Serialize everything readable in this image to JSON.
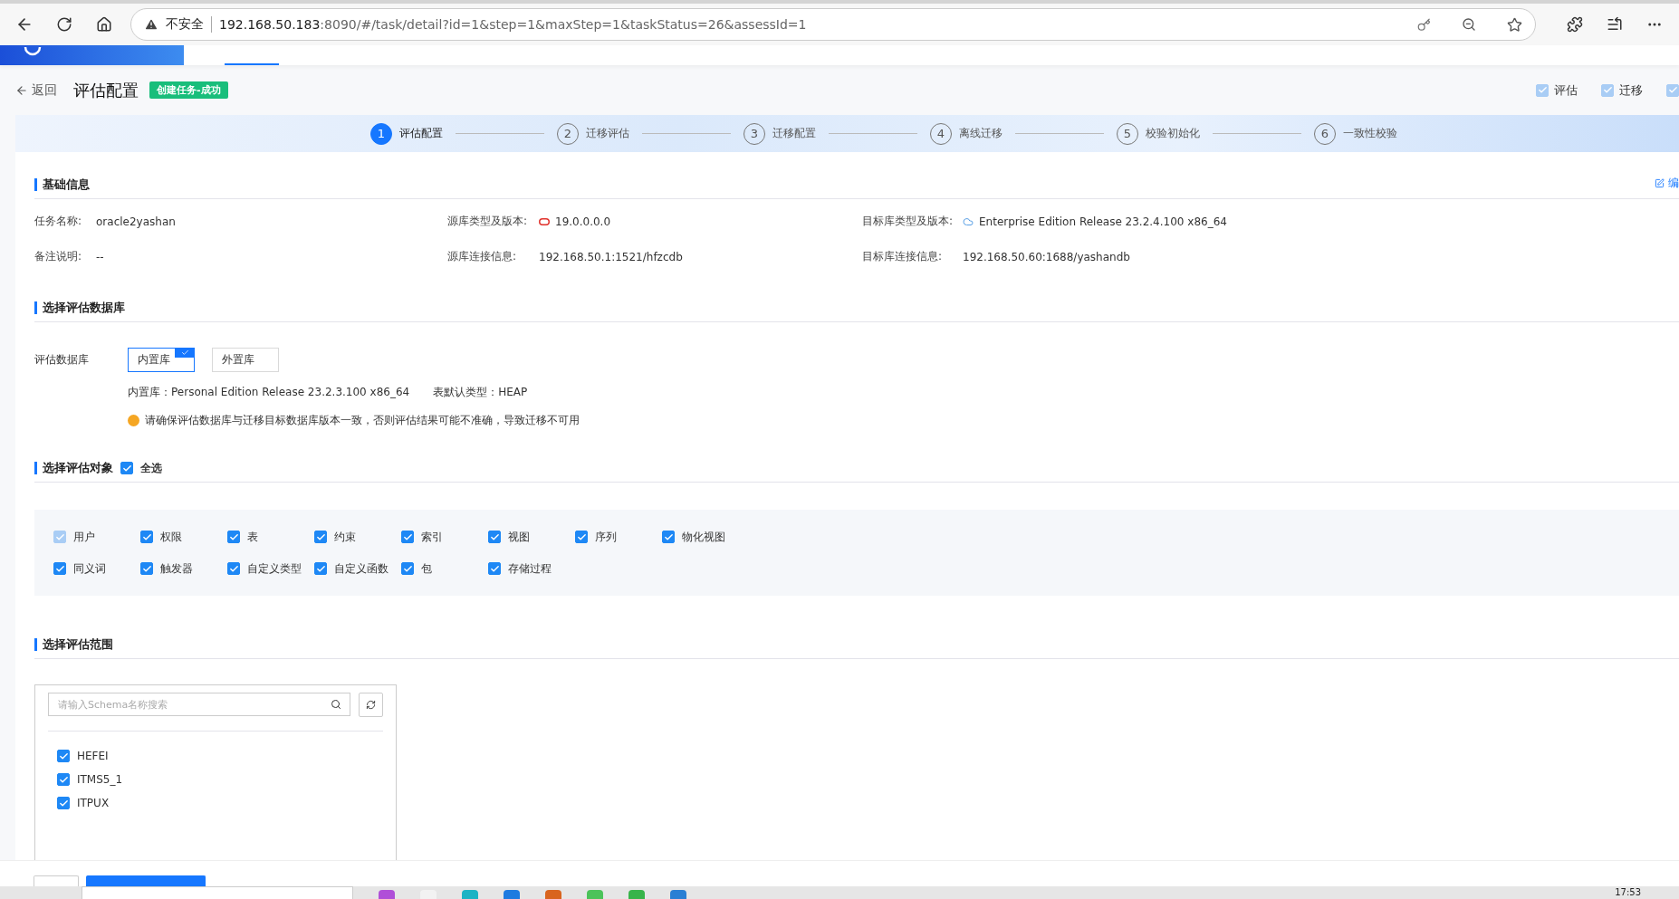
{
  "browser": {
    "security": "不安全",
    "url_host": "192.168.50.183",
    "url_rest": ":8090/#/task/detail?id=1&step=1&maxStep=1&taskStatus=26&assessId=1"
  },
  "app_header": {
    "nav": [
      {
        "selected": true
      },
      {
        "selected": false
      }
    ]
  },
  "page_header": {
    "back": "返回",
    "title": "评估配置",
    "badge": "创建任务-成功",
    "toggles": [
      {
        "label": "评估",
        "checked": true
      },
      {
        "label": "迁移",
        "checked": true
      },
      {
        "checked": true
      }
    ]
  },
  "steps": [
    {
      "number": "1",
      "label": "评估配置",
      "selected": true
    },
    {
      "number": "2",
      "label": "迁移评估",
      "selected": false
    },
    {
      "number": "3",
      "label": "迁移配置",
      "selected": false
    },
    {
      "number": "4",
      "label": "离线迁移",
      "selected": false
    },
    {
      "number": "5",
      "label": "校验初始化",
      "selected": false
    },
    {
      "number": "6",
      "label": "一致性校验",
      "selected": false
    }
  ],
  "basic_info": {
    "title": "基础信息",
    "edit": "编",
    "fields": [
      {
        "label": "任务名称:",
        "value": "oracle2yashan"
      },
      {
        "label": "源库类型及版本:",
        "value": "19.0.0.0.0",
        "kind": "oracle"
      },
      {
        "label": "目标库类型及版本:",
        "value": "Enterprise Edition Release 23.2.4.100 x86_64",
        "kind": "yashan"
      },
      {
        "label": "备注说明:",
        "value": "--"
      },
      {
        "label": "源库连接信息:",
        "value": "192.168.50.1:1521/hfzcdb"
      },
      {
        "label": "目标库连接信息:",
        "value": "192.168.50.60:1688/yashandb"
      }
    ]
  },
  "assess_db": {
    "title": "选择评估数据库",
    "label": "评估数据库",
    "options": [
      {
        "label": "内置库",
        "selected": true
      },
      {
        "label": "外置库",
        "selected": false
      }
    ],
    "info": "内置库：Personal Edition Release 23.2.3.100 x86_64",
    "table_type": "表默认类型：HEAP",
    "warning": "请确保评估数据库与迁移目标数据库版本一致，否则评估结果可能不准确，导致迁移不可用"
  },
  "objects": {
    "title": "选择评估对象",
    "select_all": {
      "label": "全选",
      "checked": true
    },
    "items": [
      {
        "label": "用户",
        "checked": true,
        "disabled": true
      },
      {
        "label": "权限",
        "checked": true,
        "disabled": false
      },
      {
        "label": "表",
        "checked": true,
        "disabled": false
      },
      {
        "label": "约束",
        "checked": true,
        "disabled": false
      },
      {
        "label": "索引",
        "checked": true,
        "disabled": false
      },
      {
        "label": "视图",
        "checked": true,
        "disabled": false
      },
      {
        "label": "序列",
        "checked": true,
        "disabled": false
      },
      {
        "label": "物化视图",
        "checked": true,
        "disabled": false
      },
      {
        "label": "同义词",
        "checked": true,
        "disabled": false
      },
      {
        "label": "触发器",
        "checked": true,
        "disabled": false
      },
      {
        "label": "自定义类型",
        "checked": true,
        "disabled": false
      },
      {
        "label": "自定义函数",
        "checked": true,
        "disabled": false
      },
      {
        "label": "包",
        "checked": true,
        "disabled": false
      },
      {
        "label": "存储过程",
        "checked": true,
        "disabled": false
      }
    ]
  },
  "scope": {
    "title": "选择评估范围",
    "search_placeholder": "请输入Schema名称搜索",
    "schemas": [
      {
        "label": "HEFEI",
        "checked": true
      },
      {
        "label": "ITMS5_1",
        "checked": true
      },
      {
        "label": "ITPUX",
        "checked": true
      }
    ]
  },
  "footer": {
    "buttons": [
      {
        "kind": "default"
      },
      {
        "kind": "primary"
      }
    ]
  },
  "taskbar": {
    "time": "17:53"
  }
}
